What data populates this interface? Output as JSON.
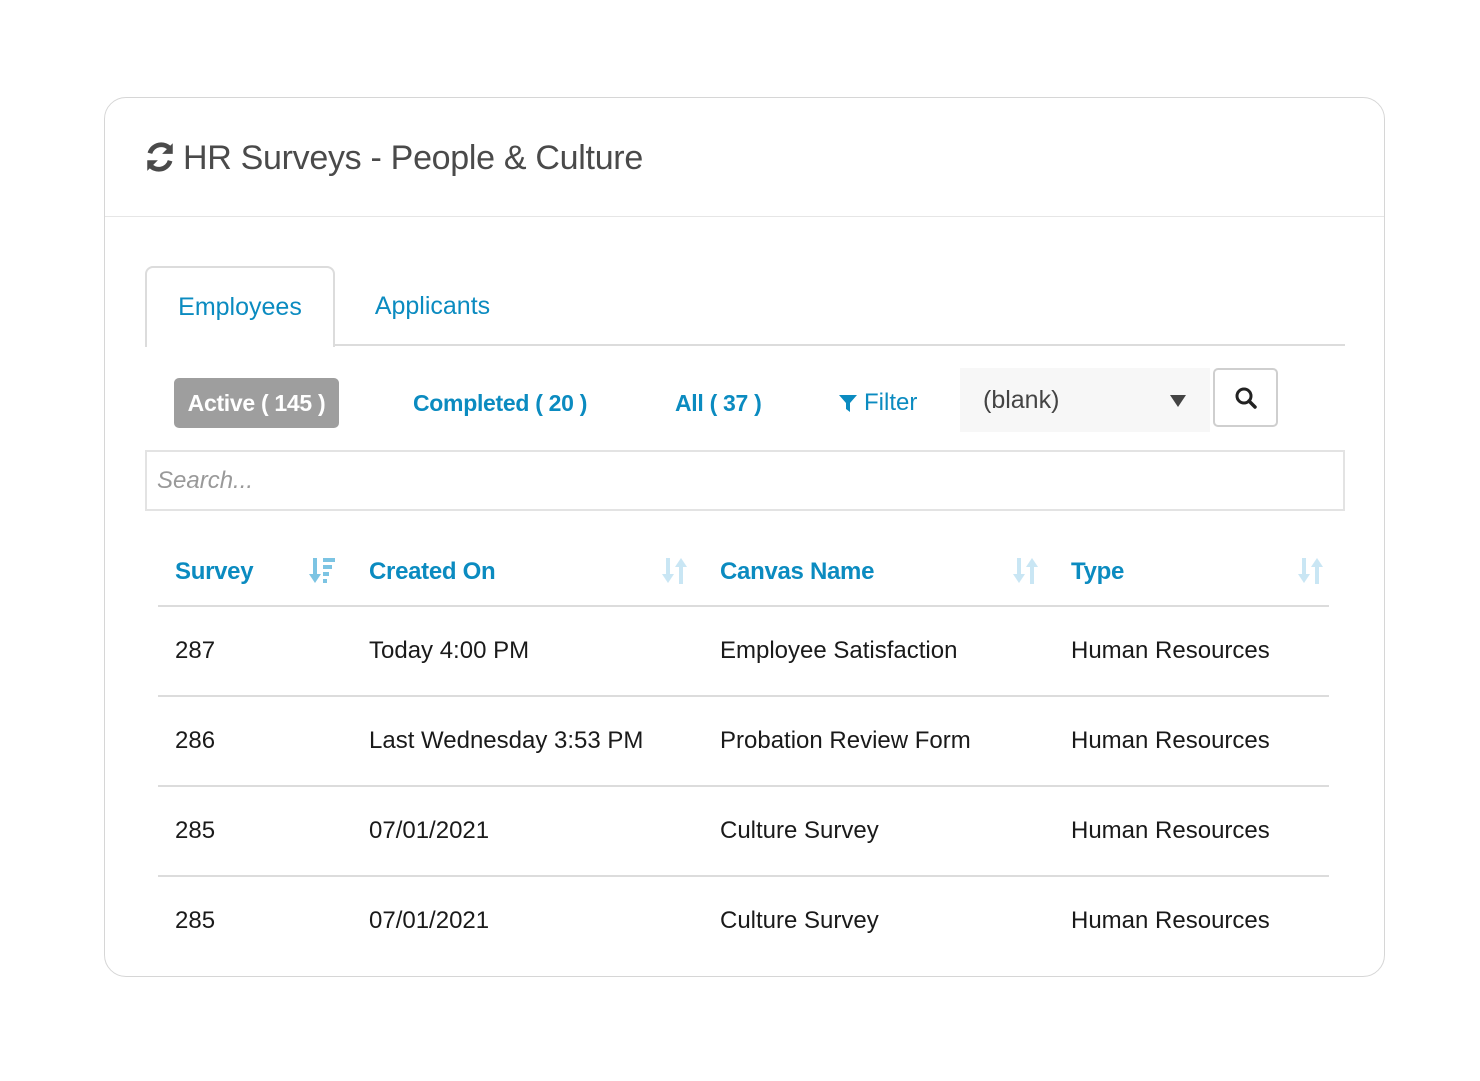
{
  "header": {
    "title": "HR Surveys - People & Culture",
    "icon": "refresh-icon"
  },
  "tabs": [
    {
      "label": "Employees",
      "active": true
    },
    {
      "label": "Applicants",
      "active": false
    }
  ],
  "status_filters": [
    {
      "label": "Active ( 145 )",
      "active": true
    },
    {
      "label": "Completed ( 20 )",
      "active": false
    },
    {
      "label": "All ( 37 )",
      "active": false
    }
  ],
  "filter": {
    "label": "Filter",
    "icon": "funnel-icon",
    "selected_value": "(blank)",
    "search_button_icon": "search-icon"
  },
  "search": {
    "placeholder": "Search...",
    "value": ""
  },
  "table": {
    "columns": [
      {
        "label": "Survey",
        "sort": "descending"
      },
      {
        "label": "Created On",
        "sort": "none"
      },
      {
        "label": "Canvas Name",
        "sort": "none"
      },
      {
        "label": "Type",
        "sort": "none"
      }
    ],
    "rows": [
      {
        "survey": "287",
        "created_on": "Today 4:00 PM",
        "canvas_name": "Employee Satisfaction",
        "type": "Human Resources"
      },
      {
        "survey": "286",
        "created_on": "Last Wednesday 3:53 PM",
        "canvas_name": "Probation Review Form",
        "type": "Human Resources"
      },
      {
        "survey": "285",
        "created_on": "07/01/2021",
        "canvas_name": "Culture Survey",
        "type": "Human Resources"
      },
      {
        "survey": "285",
        "created_on": "07/01/2021",
        "canvas_name": "Culture Survey",
        "type": "Human Resources"
      }
    ]
  },
  "colors": {
    "accent": "#0b8bc0",
    "active_pill_bg": "#9e9e9e",
    "title_text": "#4a4a4a",
    "sort_icon_active": "#7cc4e3",
    "sort_icon_inactive": "#c9e6f4"
  }
}
